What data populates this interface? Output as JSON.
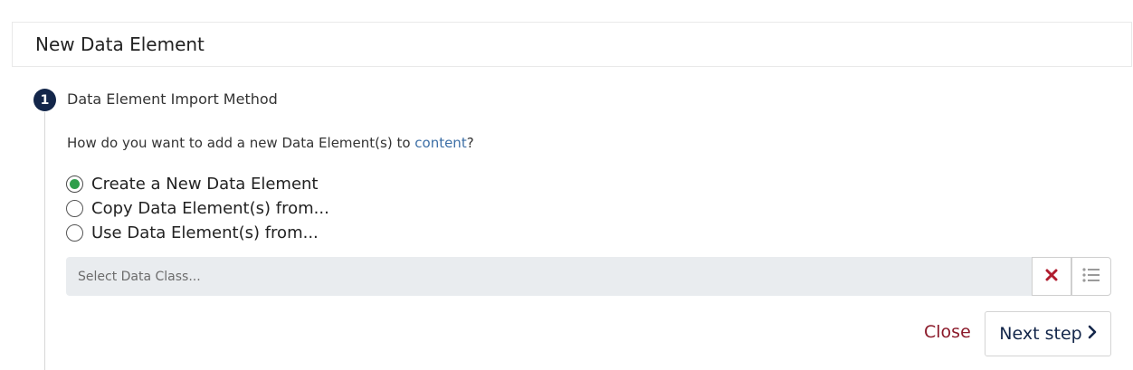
{
  "header": {
    "title": "New Data Element"
  },
  "step": {
    "number": "1",
    "title": "Data Element Import Method",
    "question_prefix": "How do you want to add a new Data Element(s) to ",
    "question_link": "content",
    "question_suffix": "?"
  },
  "options": [
    {
      "label": "Create a New Data Element",
      "selected": true
    },
    {
      "label": "Copy Data Element(s) from...",
      "selected": false
    },
    {
      "label": "Use Data Element(s) from...",
      "selected": false
    }
  ],
  "data_class_select": {
    "placeholder": "Select Data Class..."
  },
  "actions": {
    "close_label": "Close",
    "next_label": "Next step"
  },
  "colors": {
    "accent_green": "#2e9e4b",
    "navy": "#13264a",
    "close_red": "#8b1a2a",
    "link_blue": "#3d6fa6",
    "clear_icon_red": "#b01c2e"
  },
  "icons": {
    "clear": "close-icon",
    "list": "list-icon",
    "next": "chevron-right-icon"
  }
}
